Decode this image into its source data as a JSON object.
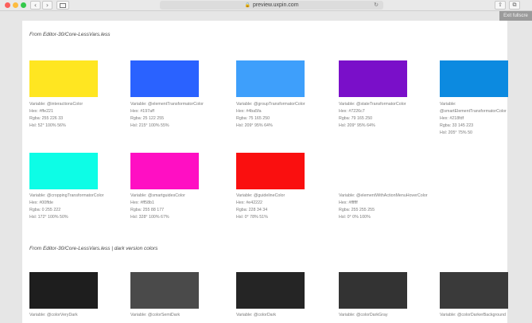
{
  "browser": {
    "url": "preview.uxpin.com",
    "back_glyph": "‹",
    "forward_glyph": "›",
    "reload_glyph": "↻",
    "share_glyph": "⇧",
    "tabs_glyph": "⧉",
    "lock_glyph": "🔒",
    "exit_fullscreen": "Exit fullscre"
  },
  "section1": {
    "title": "From Editor-30/Core-LessVars.less",
    "row1": [
      {
        "color": "#ffe221",
        "lines": [
          "Variable: @interactionsColor",
          "Hex: #ffe221",
          "Rgba: 255 226 33",
          "Hsl: 52° 100% 56%"
        ]
      },
      {
        "color": "#197aff",
        "lines": [
          "Variable: @elementTransformatorColor",
          "Hex: #197aff",
          "Rgba: 25 122 255",
          "Hsl: 215° 100% 55%"
        ]
      },
      {
        "color": "#4ba5fa",
        "lines": [
          "Variable: @groupTransformatorColor",
          "Hex: #4ba5fa",
          "Rgba: 75 165 250",
          "Hsl: 209° 95% 64%"
        ]
      },
      {
        "color": "#7226c7",
        "lines": [
          "Variable: @stateTransformatorColor",
          "Hex: #7226c7",
          "Rgba: 79 165 250",
          "Hsl: 209° 95% 64%"
        ]
      },
      {
        "color": "#218fdf",
        "lines": [
          "Variable:",
          "@smartElementTransformatorColor",
          "Hex: #218fdf",
          "Rgba: 33 145 223",
          "Hsl: 205° 75% 50"
        ]
      }
    ],
    "row2": [
      {
        "color": "#00ffde",
        "lines": [
          "Variable: @croppingTransformatorColor",
          "Hex: #00ffde",
          "Rgba: 0 255 222",
          "Hsl: 172° 100% 50%"
        ]
      },
      {
        "color": "#ff58b1",
        "lines": [
          "Variable: @smartguidesColor",
          "Hex: #ff58b1",
          "Rgba: 255 88 177",
          "Hsl: 328° 100% 67%"
        ]
      },
      {
        "color": "#e42222",
        "lines": [
          "Variable: @guidelineColor",
          "Hex: #e42222",
          "Rgba: 228 34 34",
          "Hsl: 0° 78% 51%"
        ]
      },
      {
        "color": "#ffffff",
        "lines": [
          "Variable: @elementWithActionMenuHoverColor",
          "Hex: #ffffff",
          "Rgba: 255 255 255",
          "Hsl: 0° 0% 100%"
        ]
      }
    ]
  },
  "section2": {
    "title": "From Editor-30/Core-LessVars.less | dark version colors",
    "row": [
      {
        "color": "#1e1e1e",
        "lines": [
          "Variable: @colorVeryDark"
        ]
      },
      {
        "color": "#4a4a4a",
        "lines": [
          "Variable: @colorSemiDark"
        ]
      },
      {
        "color": "#252525",
        "lines": [
          "Variable: @colorDark"
        ]
      },
      {
        "color": "#333333",
        "lines": [
          "Variable: @colorDarkGray"
        ]
      },
      {
        "color": "#3a3a3a",
        "lines": [
          "Variable: @colorDarkerBackground"
        ]
      }
    ]
  },
  "colors": {
    "row1_swatches": [
      "#ffe621",
      "#2a62ff",
      "#3e9ffb",
      "#7a0fc9",
      "#0c8ae0"
    ],
    "row2_swatches": [
      "#0dfde6",
      "#ff0fc3",
      "#fa0f0f",
      "#ffffff"
    ]
  }
}
